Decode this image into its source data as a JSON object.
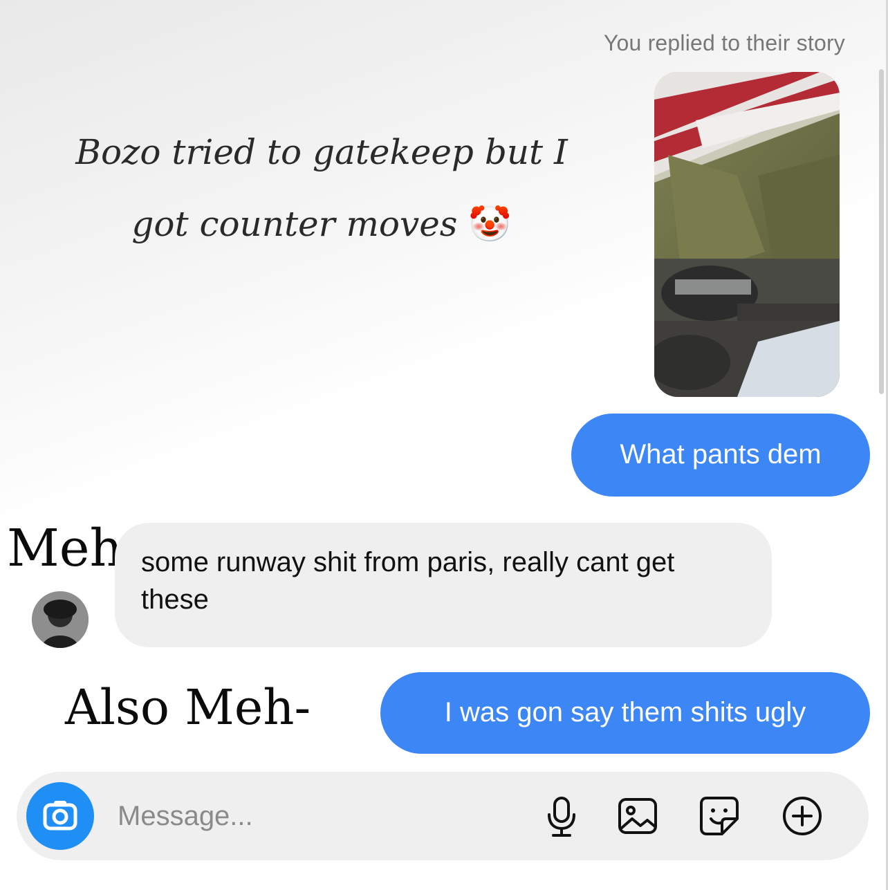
{
  "thread": {
    "story_caption": "You replied to their story",
    "story_overlay": {
      "line1": "Bozo tried to gatekeep but I",
      "line2": "got counter moves",
      "emoji": "🤡"
    },
    "messages": [
      {
        "from": "me",
        "text": "What pants dem"
      },
      {
        "from": "them",
        "text": "some runway shit from paris, really cant get these"
      },
      {
        "from": "me",
        "text": "I was gon say them shits ugly"
      }
    ]
  },
  "meme_labels": {
    "first": "Meh",
    "second": "Also Meh-"
  },
  "composer": {
    "placeholder": "Message..."
  },
  "icons": {
    "camera": "camera-icon",
    "mic": "microphone-icon",
    "gallery": "gallery-icon",
    "sticker": "sticker-icon",
    "plus": "plus-icon"
  },
  "colors": {
    "sent_bubble": "#3d86f6",
    "received_bubble": "#efefef",
    "camera_button": "#1f8ff5",
    "caption_text": "#777777"
  }
}
